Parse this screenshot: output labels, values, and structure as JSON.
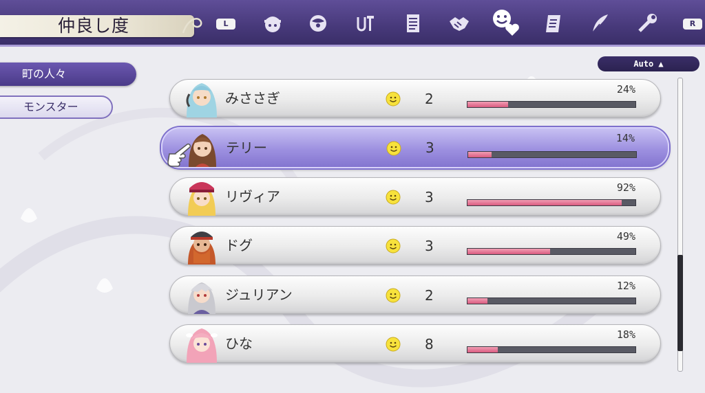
{
  "header": {
    "title": "仲良し度",
    "left_shoulder": "L",
    "right_shoulder": "R",
    "tabs": [
      {
        "name": "villager-face-icon"
      },
      {
        "name": "orb-icon"
      },
      {
        "name": "crafting-icon"
      },
      {
        "name": "notes-icon"
      },
      {
        "name": "handshake-icon"
      },
      {
        "name": "friendship-heart-icon",
        "active": true
      },
      {
        "name": "book-icon"
      },
      {
        "name": "quill-icon"
      },
      {
        "name": "wrench-settings-icon"
      }
    ]
  },
  "sidebar": {
    "items": [
      {
        "label": "町の人々",
        "active": true
      },
      {
        "label": "モンスター",
        "active": false
      }
    ]
  },
  "sort": {
    "label": "Auto ▲"
  },
  "residents": [
    {
      "name": "みささぎ",
      "level": "2",
      "percent": "24%",
      "progress": 0.24
    },
    {
      "name": "テリー",
      "level": "3",
      "percent": "14%",
      "progress": 0.14,
      "selected": true
    },
    {
      "name": "リヴィア",
      "level": "3",
      "percent": "92%",
      "progress": 0.92
    },
    {
      "name": "ドグ",
      "level": "3",
      "percent": "49%",
      "progress": 0.49
    },
    {
      "name": "ジュリアン",
      "level": "2",
      "percent": "12%",
      "progress": 0.12
    },
    {
      "name": "ひな",
      "level": "8",
      "percent": "18%",
      "progress": 0.18
    }
  ],
  "scrollbar": {
    "position_fraction": 0.9,
    "visible_fraction": 0.33
  },
  "colors": {
    "header_purple": "#47397a",
    "selected_row": "#9d90e0",
    "progress_pink": "#e07593",
    "smile_yellow": "#f7e23c"
  }
}
